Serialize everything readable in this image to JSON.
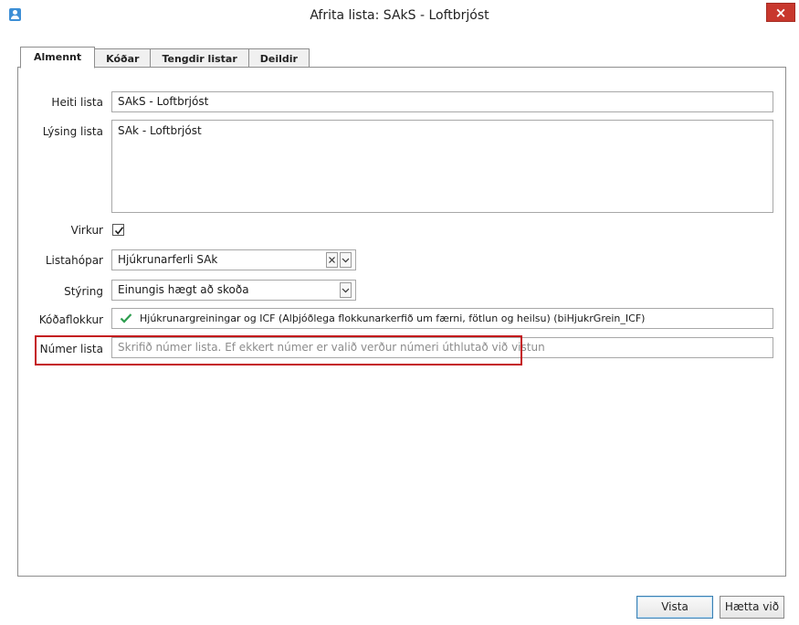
{
  "window": {
    "title": "Afrita lista: SAkS - Loftbrjóst",
    "close_label": "×"
  },
  "tabs": [
    {
      "label": "Almennt",
      "active": true
    },
    {
      "label": "Kóðar",
      "active": false
    },
    {
      "label": "Tengdir listar",
      "active": false
    },
    {
      "label": "Deildir",
      "active": false
    }
  ],
  "form": {
    "heiti": {
      "label": "Heiti lista",
      "value": "SAkS - Loftbrjóst"
    },
    "lysing": {
      "label": "Lýsing lista",
      "value": "SAk - Loftbrjóst"
    },
    "virkur": {
      "label": "Virkur",
      "checked": true
    },
    "listahopar": {
      "label": "Listahópar",
      "value": "Hjúkrunarferli SAk"
    },
    "styring": {
      "label": "Stýring",
      "value": "Einungis hægt að skoða"
    },
    "kodaflokkur": {
      "label": "Kóðaflokkur",
      "value": "Hjúkrunargreiningar og ICF (Alþjóðlega flokkunarkerfið um færni, fötlun og heilsu) (biHjukrGrein_ICF)"
    },
    "numer": {
      "label": "Númer lista",
      "value": "",
      "placeholder": "Skrifið númer lista. Ef ekkert númer er valið verður númeri úthlutað við vistun"
    }
  },
  "buttons": {
    "save": "Vista",
    "cancel": "Hætta við"
  },
  "colors": {
    "highlight": "#c4161c",
    "close": "#c8372d",
    "check": "#2e9e4f"
  }
}
